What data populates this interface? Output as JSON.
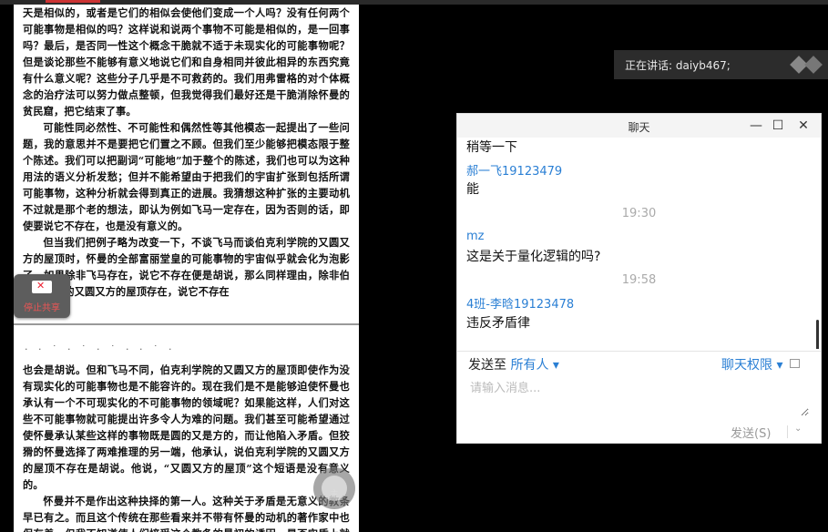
{
  "document": {
    "page1_paragraphs": [
      "天是相似的，或者是它们的相似会使他们变成一个人吗？没有任何两个可能事物是相似的吗？这样说和说两个事物不可能是相似的，是一回事吗？最后，是否同一性这个概念干脆就不适于未现实化的可能事物呢？但是谈论那些不能够有意义地说它们和自身相同并彼此相异的东西究竟有什么意义呢？这些分子几乎是不可救药的。我们用弗雷格的对个体概念的治疗法可以努力做点整顿，但我觉得我们最好还是干脆消除怀曼的贫民窟，把它结束了事。",
      "可能性同必然性、不可能性和偶然性等其他模态一起提出了一些问题，我的意思并不是要把它们置之不顾。但我们至少能够把模态限于整个陈述。我们可以把副词“可能地”加于整个的陈述，我们也可以为这种用法的语义分析发愁；但并不能希望由于把我们的宇宙扩张到包括所谓可能事物，这种分析就会得到真正的进展。我猜想这种扩张的主要动机不过就是那个老的想法，即认为例如飞马一定存在，因为否则的话，即使要说它不存在，也是没有意义的。",
      "但当我们把例子略为改变一下，不谈飞马而谈伯克利学院的又圆又方的屋顶时，怀曼的全部富丽堂皇的可能事物的宇宙似乎就会化为泡影了。如果除非飞马存在，说它不存在便是胡说，那么同样理由，除非伯克利学院的又圆又方的屋顶存在，说它不存在"
    ],
    "page2_speckles": "· ·  ˙   · ˙    ·  ˙  ·   ·  ˙ ·",
    "page2_paragraphs": [
      "也会是胡说。但和飞马不同，伯克利学院的又圆又方的屋顶即使作为没有现实化的可能事物也是不能容许的。现在我们是不是能够迫使怀曼也承认有一个不可现实化的不可能事物的领域呢？如果能这样，人们对这些不可能事物就可能提出许多令人为难的问题。我们甚至可能希望通过使怀曼承认某些这样的事物既是圆的又是方的，而让他陷入矛盾。但狡猾的怀曼选择了两难推理的另一端，他承认，说伯克利学院的又圆又方的屋顶不存在是胡说。他说，“又圆又方的屋顶”这个短语是没有意义的。",
      "怀曼并不是作出这种抉择的第一人。这种关于矛盾是无意义的教条早已有之。而且这个传统在那些看来并不带有怀曼的动机的著作家中也保存着。但我不知道使人们接受这个教条的最初的诱因，是否实质上就是我们在怀曼那里所观察到的那种动机。这"
    ]
  },
  "stop_share": {
    "label": "停止共享"
  },
  "float_button": {
    "label": "主"
  },
  "speaking": {
    "text": "正在讲话: daiyb467;"
  },
  "chat": {
    "title": "聊天",
    "window_buttons": {
      "minimize": "—",
      "maximize": "☐",
      "close": "✕"
    },
    "messages": [
      {
        "kind": "text",
        "text": "稍等一下"
      },
      {
        "kind": "name",
        "text": "郝一飞19123479"
      },
      {
        "kind": "text",
        "text": "能"
      },
      {
        "kind": "time",
        "text": "19:30"
      },
      {
        "kind": "name",
        "text": "mz"
      },
      {
        "kind": "text",
        "text": "这是关于量化逻辑的吗?"
      },
      {
        "kind": "time",
        "text": "19:58"
      },
      {
        "kind": "name",
        "text": "4班-李晗19123478"
      },
      {
        "kind": "text",
        "text": "违反矛盾律"
      }
    ],
    "send_to_label": "发送至",
    "send_to_value": "所有人",
    "dropdown_arrow": "▾",
    "permission_label": "聊天权限",
    "input_placeholder": "请输入消息...",
    "send_button": "发送(S)",
    "send_arrow": "⌄",
    "colors": {
      "accent": "#2a7fd4",
      "muted": "#aaaaaa"
    }
  }
}
